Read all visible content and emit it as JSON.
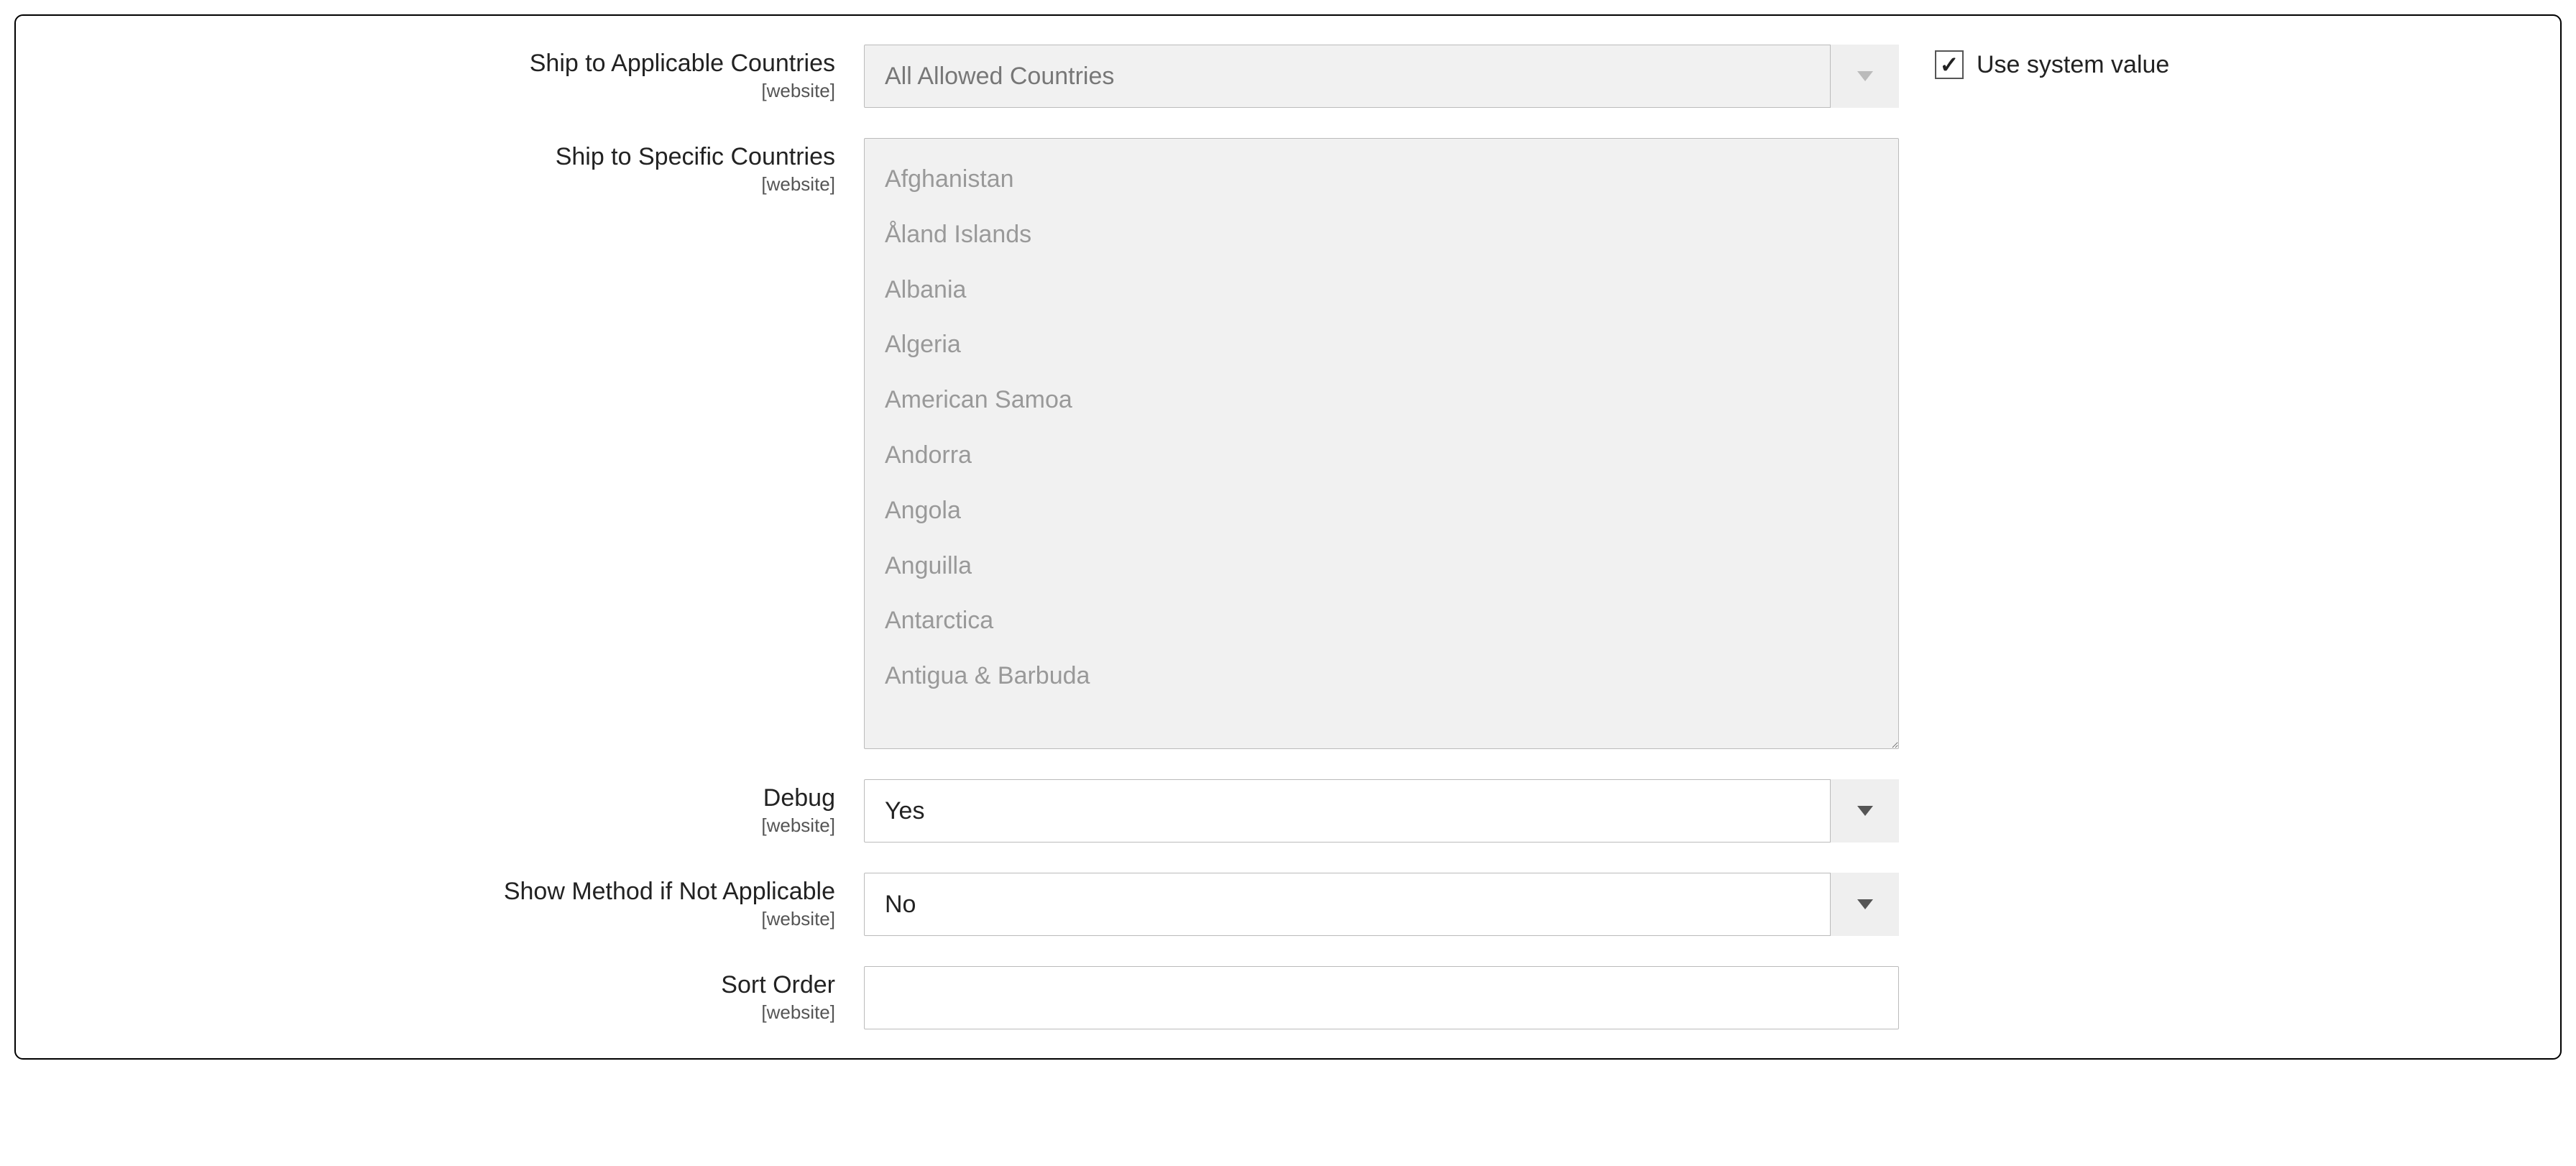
{
  "fields": {
    "ship_applicable": {
      "label": "Ship to Applicable Countries",
      "scope": "[website]",
      "value": "All Allowed Countries",
      "disabled": true,
      "use_system_label": "Use system value",
      "use_system_checked": true
    },
    "ship_specific": {
      "label": "Ship to Specific Countries",
      "scope": "[website]",
      "options": [
        "Afghanistan",
        "Åland Islands",
        "Albania",
        "Algeria",
        "American Samoa",
        "Andorra",
        "Angola",
        "Anguilla",
        "Antarctica",
        "Antigua & Barbuda"
      ]
    },
    "debug": {
      "label": "Debug",
      "scope": "[website]",
      "value": "Yes"
    },
    "show_method": {
      "label": "Show Method if Not Applicable",
      "scope": "[website]",
      "value": "No"
    },
    "sort_order": {
      "label": "Sort Order",
      "scope": "[website]",
      "value": ""
    }
  }
}
